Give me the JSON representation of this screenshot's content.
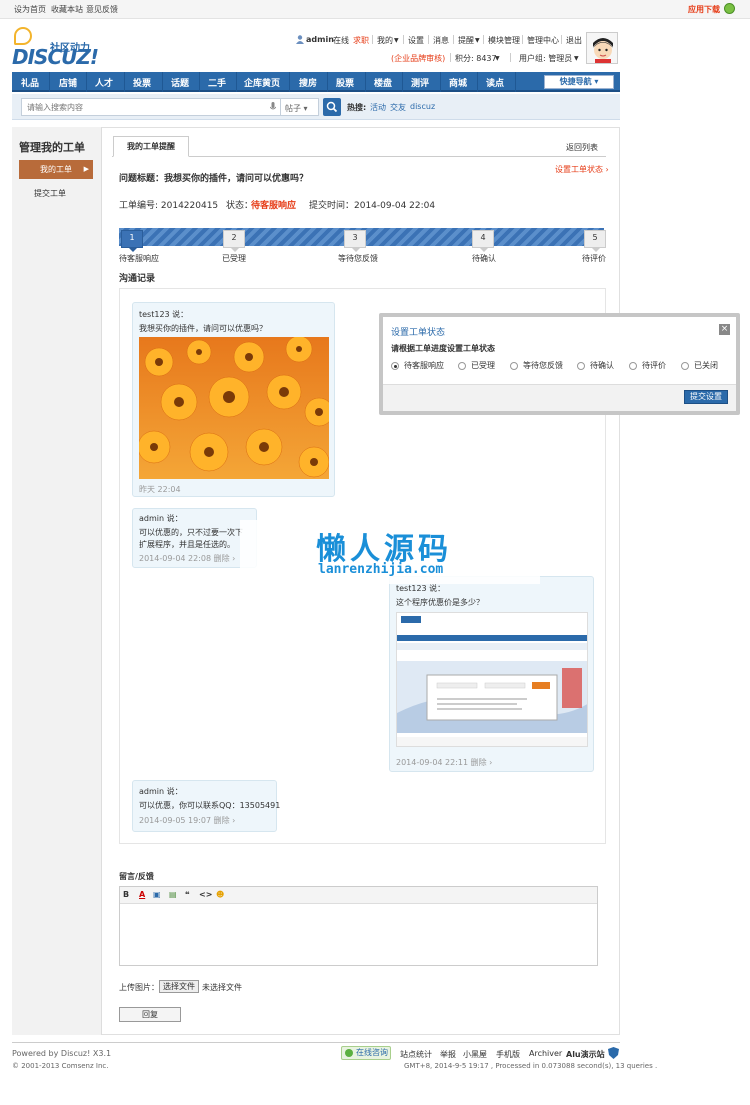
{
  "topbar": {
    "set_home": "设为首页",
    "bookmark": "收藏本站",
    "feedback": "意见反馈",
    "app_download": "应用下载"
  },
  "logo": {
    "sub": "社区动力",
    "main": "DISCUZ!"
  },
  "usermenu": {
    "username": "admin",
    "status": "在线",
    "job": "求职",
    "my": "我的",
    "settings": "设置",
    "messages": "消息",
    "reminders": "提醒",
    "module_manage": "模块管理",
    "admin_center": "管理中心",
    "logout": "退出",
    "enterprise": "(企业品牌审核)",
    "points": "积分: 8437",
    "group": "用户组: 管理员"
  },
  "nav": {
    "items": [
      "礼品",
      "店铺",
      "人才",
      "投票",
      "话题",
      "二手",
      "企库黄页",
      "搜房",
      "股票",
      "楼盘",
      "测评",
      "商城",
      "读点"
    ],
    "quick_nav": "快捷导航"
  },
  "search": {
    "placeholder": "请输入搜索内容",
    "type": "帖子",
    "hot_label": "热搜:",
    "hot": [
      "活动",
      "交友",
      "discuz"
    ]
  },
  "sidebar": {
    "title": "管理我的工单",
    "active": "我的工单",
    "item": "提交工单"
  },
  "main": {
    "tab": "我的工单提醒",
    "back": "返回列表",
    "set_status": "设置工单状态 ›",
    "question_title": "问题标题：我想买你的插件，请问可以优惠吗？",
    "ticket_no": "工单编号: 2014220415",
    "status_label": "状态：",
    "status_value": "待客服响应",
    "submit_time": "提交时间：2014-09-04 22:04",
    "steps": [
      {
        "num": "1",
        "label": "待客服响应"
      },
      {
        "num": "2",
        "label": "已受理"
      },
      {
        "num": "3",
        "label": "等待您反馈"
      },
      {
        "num": "4",
        "label": "待确认"
      },
      {
        "num": "5",
        "label": "待评价"
      }
    ],
    "comm_title": "沟通记录"
  },
  "messages": [
    {
      "who": "test123 说：",
      "text": "我想买你的插件，请问可以优惠吗？",
      "time": "昨天 22:04"
    },
    {
      "who": "admin 说：",
      "text1": "可以优惠的，只不过要一次下",
      "text2": "扩展程序，并且是任选的。",
      "time": "2014-09-04 22:08 删除 ›"
    },
    {
      "who": "test123 说：",
      "text": "这个程序优惠价是多少？",
      "time": "2014-09-04 22:11 删除 ›"
    },
    {
      "who": "admin 说：",
      "text": "可以优惠，你可以联系QQ：13505491",
      "time": "2014-09-05 19:07 删除 ›"
    }
  ],
  "dialog": {
    "title": "设置工单状态",
    "close": "×",
    "subtitle": "请根据工单进度设置工单状态",
    "options": [
      "待客服响应",
      "已受理",
      "等待您反馈",
      "待确认",
      "待评价",
      "已关闭"
    ],
    "submit": "提交设置"
  },
  "watermark": {
    "cn": "懒人源码",
    "en": "lanrenzhijia.com"
  },
  "feedback": {
    "label": "留言/反馈",
    "toolbar": [
      "B",
      "A",
      "▣",
      "▤",
      "❝",
      "<>",
      "☻"
    ],
    "upload_label": "上传图片：",
    "choose_file": "选择文件",
    "no_file": "未选择文件",
    "reply": "回复"
  },
  "footer": {
    "powered": "Powered by Discuz! X3.1",
    "copyright": "© 2001-2013 Comsenz Inc.",
    "online": "在线咨询",
    "links": [
      "站点统计",
      "举报",
      "小黑屋",
      "手机版",
      "Archiver",
      "Alu演示站"
    ],
    "gmt": "GMT+8, 2014-9-5 19:17 , Processed in 0.073088 second(s), 13 queries ."
  },
  "colors": {
    "brand": "#2b6aaa",
    "accent": "#e63c17",
    "sidebar_active": "#b86b3a"
  }
}
